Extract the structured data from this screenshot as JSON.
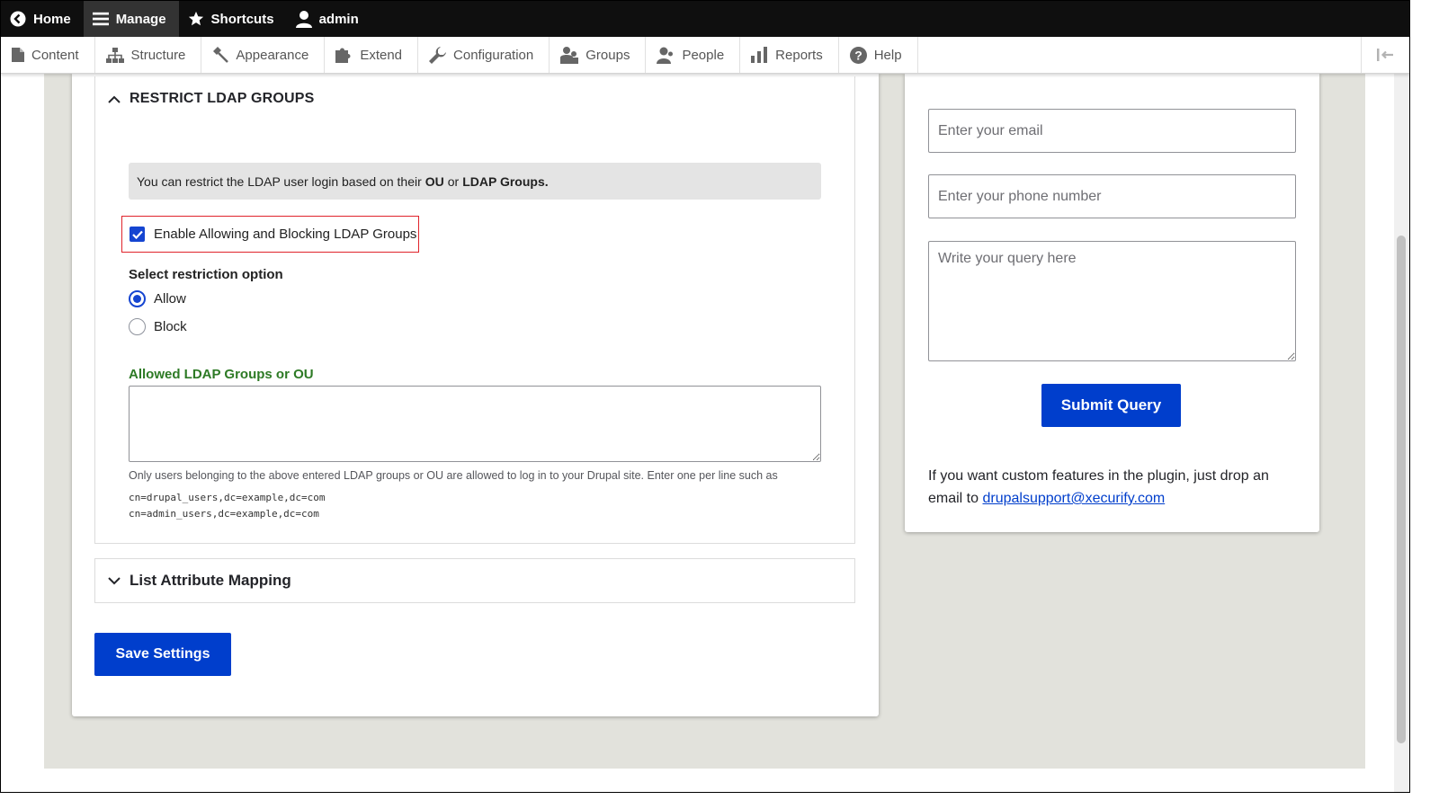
{
  "toolbar": {
    "home": "Home",
    "manage": "Manage",
    "shortcuts": "Shortcuts",
    "user": "admin"
  },
  "tray": {
    "items": [
      "Content",
      "Structure",
      "Appearance",
      "Extend",
      "Configuration",
      "Groups",
      "People",
      "Reports",
      "Help"
    ]
  },
  "restrict": {
    "summary": "RESTRICT LDAP GROUPS",
    "info_prefix": "You can restrict the LDAP user login based on their",
    "info_ou": "OU",
    "info_or": "or",
    "info_groups": "LDAP Groups.",
    "enable_label": "Enable Allowing and Blocking LDAP Groups",
    "enable_checked": true,
    "option_label": "Select restriction option",
    "option_allow": "Allow",
    "option_block": "Block",
    "selected_option": "Allow",
    "groups_label": "Allowed LDAP Groups or OU",
    "groups_value": "",
    "description": "Only users belonging to the above entered LDAP groups or OU are allowed to log in to your Drupal site. Enter one per line such as",
    "example1": "cn=drupal_users,dc=example,dc=com",
    "example2": "cn=admin_users,dc=example,dc=com"
  },
  "mapping": {
    "summary": "List Attribute Mapping"
  },
  "save_button": "Save Settings",
  "support": {
    "email_placeholder": "Enter your email",
    "phone_placeholder": "Enter your phone number",
    "query_placeholder": "Write your query here",
    "submit": "Submit Query",
    "custom_text": "If you want custom features in the plugin, just drop an email to",
    "email_link": "drupalsupport@xecurify.com"
  },
  "colors": {
    "primary": "#003ecc",
    "highlight_border": "#e0232b",
    "green_label": "#2d7a25",
    "toolbar_bg": "#0f0f0f"
  }
}
